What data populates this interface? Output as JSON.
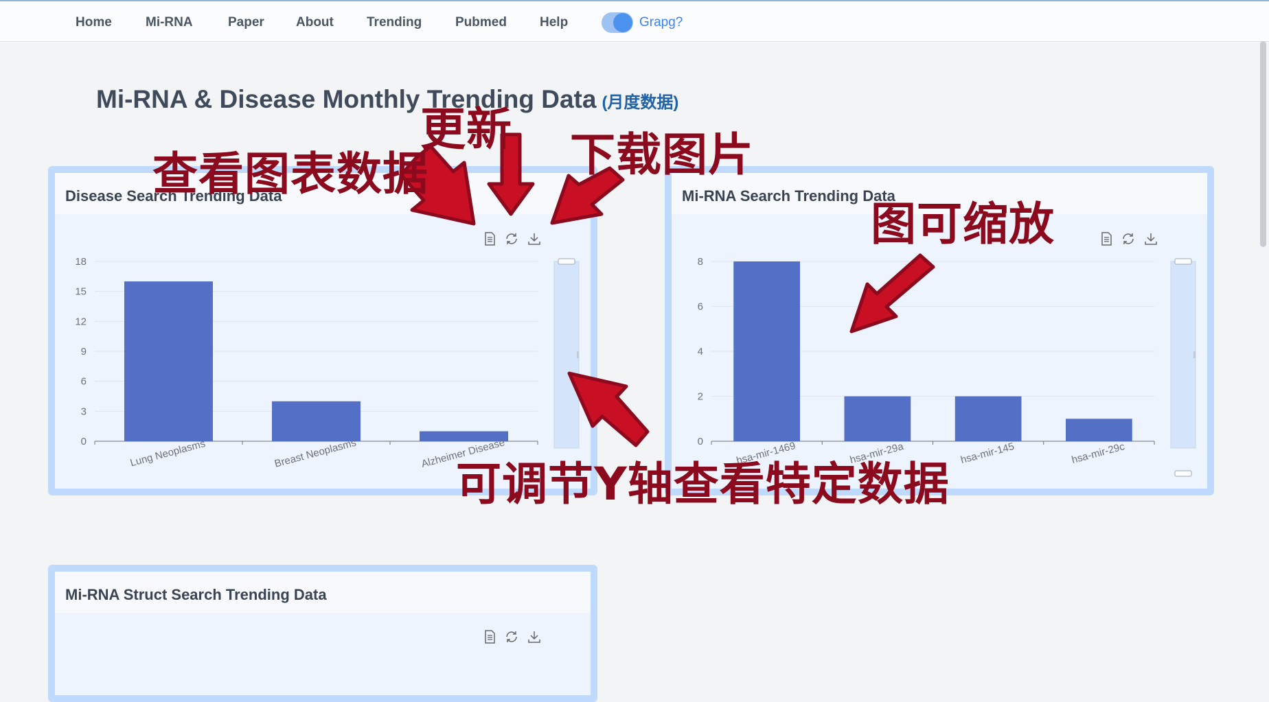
{
  "nav": {
    "items": [
      "Home",
      "Mi-RNA",
      "Paper",
      "About",
      "Trending",
      "Pubmed",
      "Help"
    ],
    "graph_label": "Grapg?"
  },
  "page": {
    "title": "Mi-RNA & Disease Monthly Trending Data",
    "subtitle": "(月度数据)"
  },
  "panels": {
    "disease": {
      "title": "Disease Search Trending Data"
    },
    "mirna": {
      "title": "Mi-RNA Search Trending Data"
    },
    "struct": {
      "title": "Mi-RNA Struct Search Trending Data"
    }
  },
  "toolbox": {
    "icons": [
      "data-view-icon",
      "refresh-icon",
      "download-icon"
    ]
  },
  "annotations": {
    "data_view": "查看图表数据",
    "refresh": "更新",
    "download": "下载图片",
    "zoom": "图可缩放",
    "adjust_y": "可调节Y轴查看特定数据",
    "arrow_color": "#8b0a1e",
    "arrow_fill": "#c90f24"
  },
  "colors": {
    "bar": "#5470c6",
    "panel_border": "#bfdafc",
    "accent": "#3b82f6"
  },
  "chart_data": [
    {
      "type": "bar",
      "title": "Disease Search Trending Data",
      "categories": [
        "Lung Neoplasms",
        "Breast Neoplasms",
        "Alzheimer Disease"
      ],
      "values": [
        16,
        4,
        1
      ],
      "yticks": [
        0,
        3,
        6,
        9,
        12,
        15,
        18
      ],
      "ylim": [
        0,
        18
      ],
      "grid": true,
      "legend": "none"
    },
    {
      "type": "bar",
      "title": "Mi-RNA Search Trending Data",
      "categories": [
        "hsa-mir-1469",
        "hsa-mir-29a",
        "hsa-mir-145",
        "hsa-mir-29c"
      ],
      "values": [
        8,
        2,
        2,
        1
      ],
      "yticks": [
        0,
        2,
        4,
        6,
        8
      ],
      "ylim": [
        0,
        8
      ],
      "grid": true,
      "legend": "none"
    }
  ]
}
